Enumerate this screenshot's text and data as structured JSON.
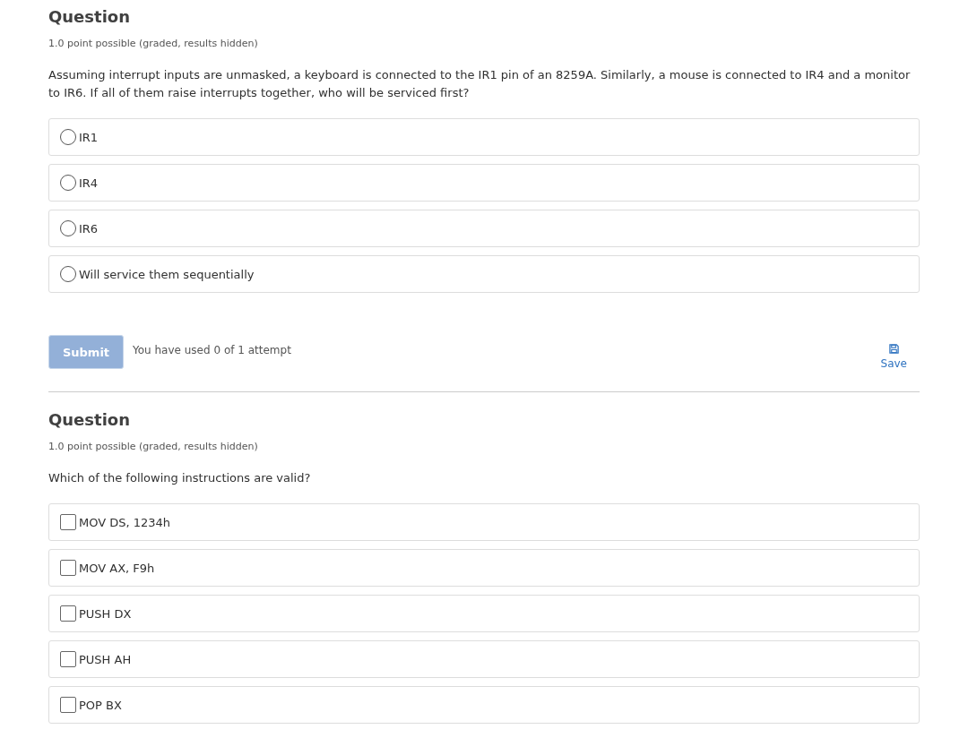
{
  "questions": [
    {
      "title": "Question",
      "points": "1.0 point possible (graded, results hidden)",
      "prompt": "Assuming interrupt inputs are unmasked, a keyboard is connected to the IR1 pin of an 8259A. Similarly, a mouse is connected to IR4 and a monitor to IR6. If all of them raise interrupts together, who will be serviced first?",
      "kind": "radio",
      "options": [
        {
          "label": "IR1",
          "selected": false
        },
        {
          "label": "IR4",
          "selected": false
        },
        {
          "label": "IR6",
          "selected": false
        },
        {
          "label": "Will service them sequentially",
          "selected": false
        }
      ],
      "actions": {
        "submit": {
          "label": "Submit",
          "disabled": true
        },
        "attempts": "You have used 0 of 1 attempt",
        "save": "Save"
      }
    },
    {
      "title": "Question",
      "points": "1.0 point possible (graded, results hidden)",
      "prompt": "Which of the following instructions are valid?",
      "kind": "checkbox",
      "options": [
        {
          "label": "MOV DS, 1234h",
          "selected": false
        },
        {
          "label": "MOV AX, F9h",
          "selected": false
        },
        {
          "label": "PUSH DX",
          "selected": false
        },
        {
          "label": "PUSH AH",
          "selected": false
        },
        {
          "label": "POP BX",
          "selected": false
        }
      ]
    }
  ]
}
